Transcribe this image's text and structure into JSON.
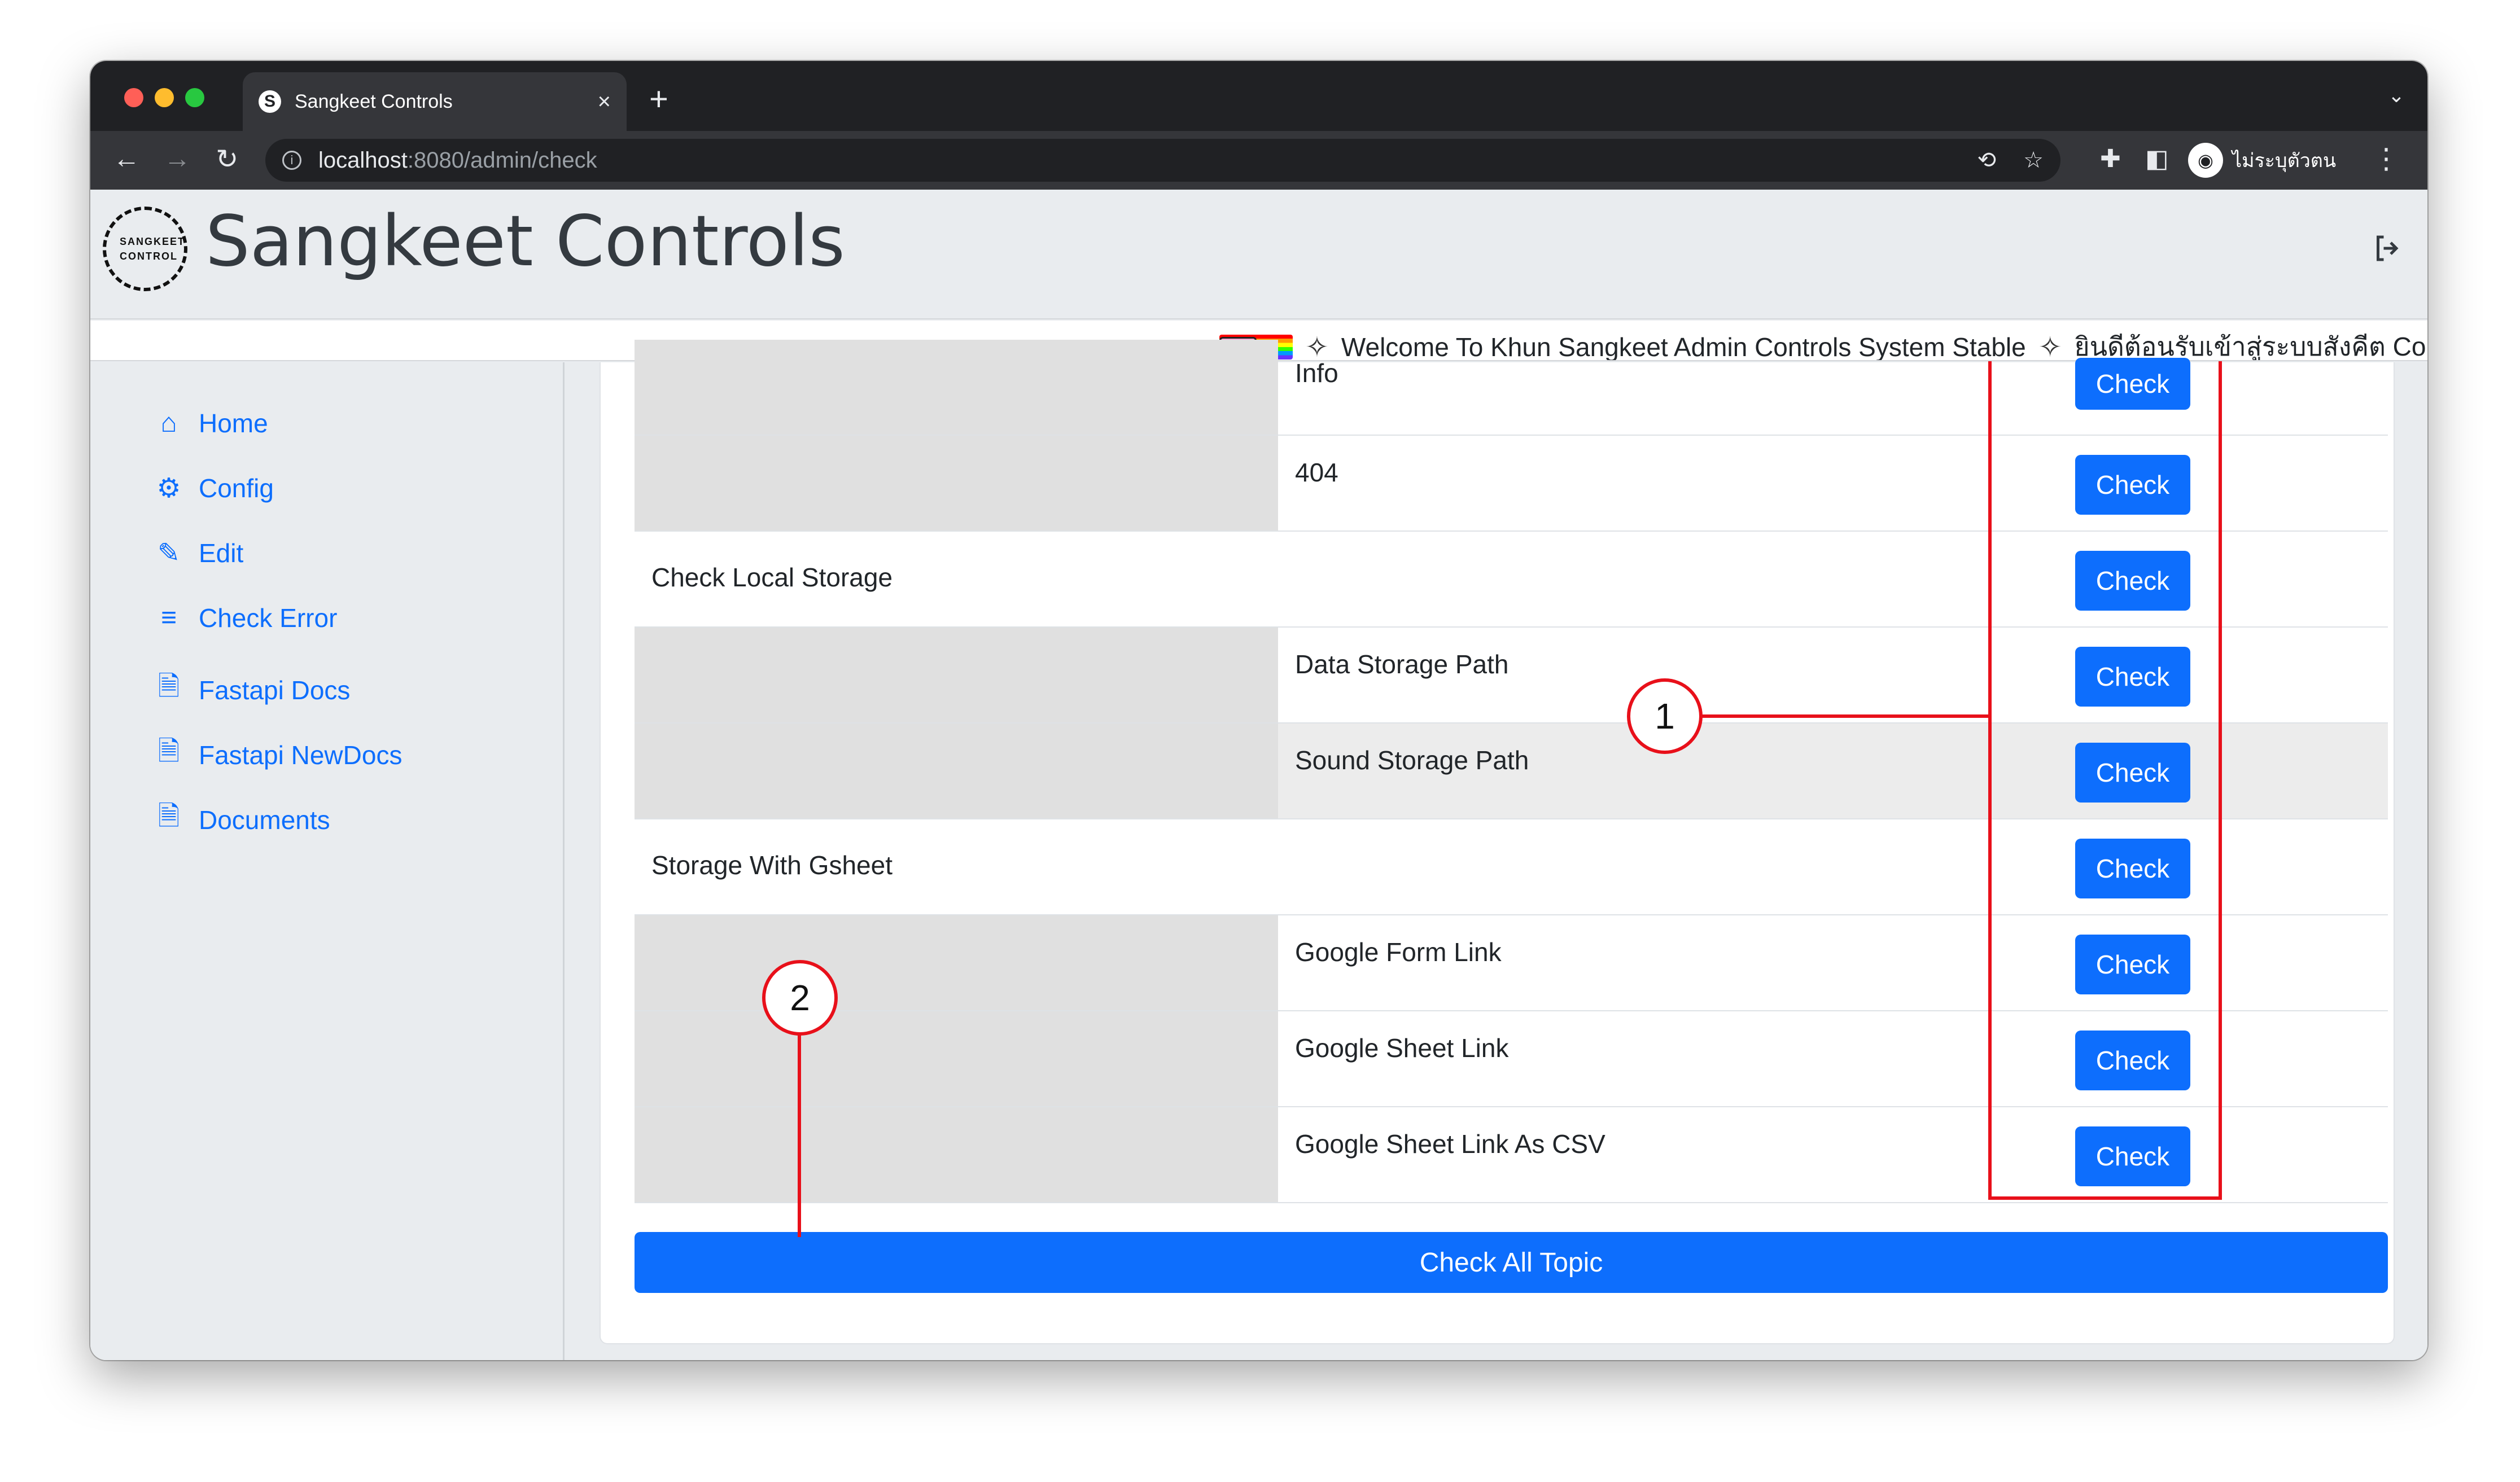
{
  "browser": {
    "tab_title": "Sangkeet Controls",
    "tab_favicon": "S",
    "tab_close": "×",
    "new_tab": "+",
    "tab_menu": "⌄",
    "url_host": "localhost",
    "url_path": ":8080/admin/check",
    "nav_back": "←",
    "nav_forward": "→",
    "nav_reload": "↻",
    "profile_name": "ไม่ระบุตัวตน"
  },
  "header": {
    "logo_text": "SANGKEET CONTROL",
    "title": "Sangkeet Controls"
  },
  "marquee": {
    "text_en": "Welcome To Khun Sangkeet Admin Controls System Stable",
    "text_th": "ยินดีต้อนรับเข้าสู่ระบบสังคีต Co"
  },
  "sidebar": {
    "items": [
      {
        "label": "Home",
        "icon": "home-icon"
      },
      {
        "label": "Config",
        "icon": "gear-icon"
      },
      {
        "label": "Edit",
        "icon": "pencil-icon"
      },
      {
        "label": "Check Error",
        "icon": "list-check-icon"
      },
      {
        "label": "Fastapi Docs",
        "icon": "document-icon"
      },
      {
        "label": "Fastapi NewDocs",
        "icon": "document-icon"
      },
      {
        "label": "Documents",
        "icon": "document-icon"
      }
    ]
  },
  "table": {
    "check_label": "Check",
    "rows": [
      {
        "label": "Info",
        "kind": "sub"
      },
      {
        "label": "404",
        "kind": "sub"
      },
      {
        "label": "Check Local Storage",
        "kind": "topic"
      },
      {
        "label": "Data Storage Path",
        "kind": "sub"
      },
      {
        "label": "Sound Storage Path",
        "kind": "sub"
      },
      {
        "label": "Storage With Gsheet",
        "kind": "topic"
      },
      {
        "label": "Google Form Link",
        "kind": "sub"
      },
      {
        "label": "Google Sheet Link",
        "kind": "sub"
      },
      {
        "label": "Google Sheet Link As CSV",
        "kind": "sub"
      }
    ]
  },
  "check_all_label": "Check All Topic",
  "annotations": {
    "marker_1": "1",
    "marker_2": "2"
  },
  "colors": {
    "primary": "#0d6efd",
    "annotation": "#e8101a"
  }
}
